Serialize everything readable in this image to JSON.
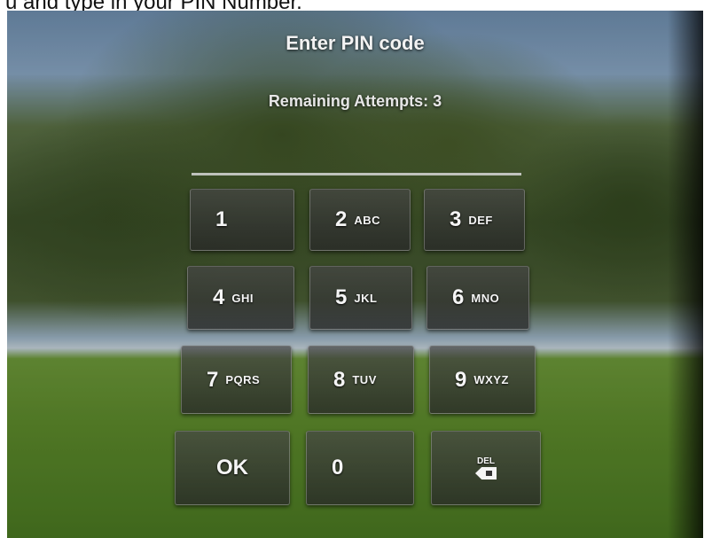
{
  "caption": "u and type in your PIN Number.",
  "screen": {
    "title": "Enter PIN code",
    "attempts_label": "Remaining Attempts: 3"
  },
  "keypad": {
    "keys": [
      {
        "digit": "1",
        "letters": ""
      },
      {
        "digit": "2",
        "letters": "ABC"
      },
      {
        "digit": "3",
        "letters": "DEF"
      },
      {
        "digit": "4",
        "letters": "GHI"
      },
      {
        "digit": "5",
        "letters": "JKL"
      },
      {
        "digit": "6",
        "letters": "MNO"
      },
      {
        "digit": "7",
        "letters": "PQRS"
      },
      {
        "digit": "8",
        "letters": "TUV"
      },
      {
        "digit": "9",
        "letters": "WXYZ"
      }
    ],
    "ok_label": "OK",
    "zero_label": "0",
    "del_label": "DEL",
    "del_icon": "backspace-icon"
  }
}
